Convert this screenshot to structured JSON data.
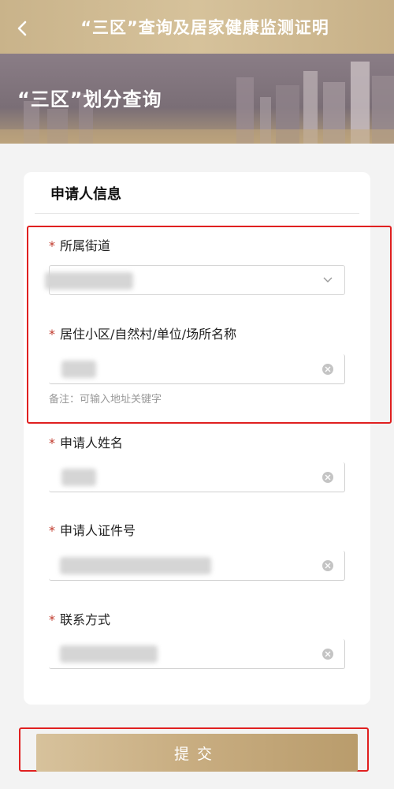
{
  "header": {
    "title": "“三区”查询及居家健康监测证明",
    "back_icon": "chevron-left-icon",
    "color": "#c9b38a"
  },
  "banner": {
    "title": "“三区”划分查询"
  },
  "form": {
    "section_title": "申请人信息",
    "required_mark": "*",
    "fields": [
      {
        "label": "所属街道",
        "type": "select",
        "icon": "chevron-down-icon"
      },
      {
        "label": "居住小区/自然村/单位/场所名称",
        "type": "text",
        "icon": "clear-icon"
      },
      {
        "label": "申请人姓名",
        "type": "text",
        "icon": "clear-icon"
      },
      {
        "label": "申请人证件号",
        "type": "text",
        "icon": "clear-icon"
      },
      {
        "label": "联系方式",
        "type": "text",
        "icon": "clear-icon"
      }
    ],
    "hint": "备注：可输入地址关键字"
  },
  "submit": {
    "label": "提交"
  },
  "colors": {
    "accent": "#c9ae82",
    "required": "#c0392b",
    "highlight": "#e02020"
  }
}
